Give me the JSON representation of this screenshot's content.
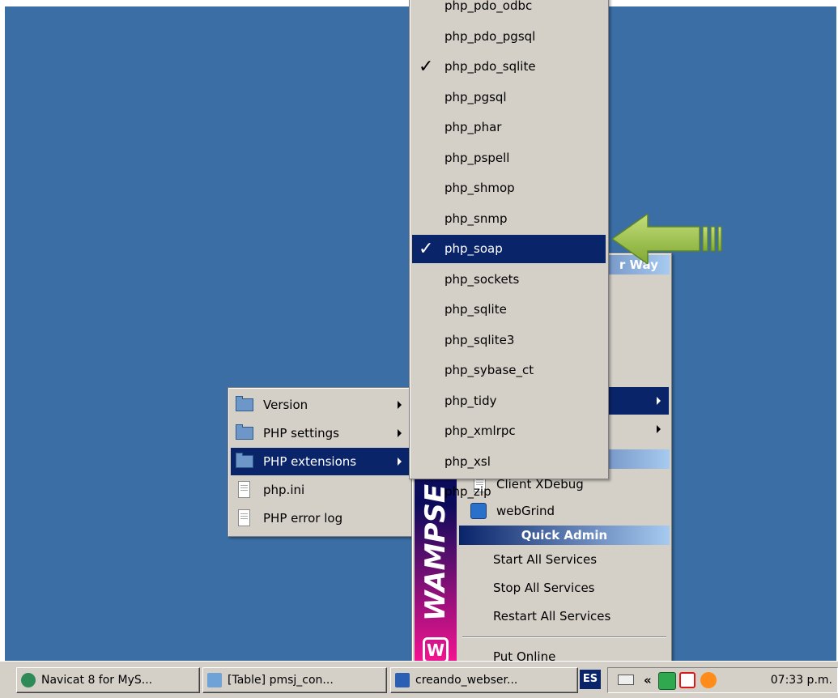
{
  "colors": {
    "desktop": "#3A6EA5",
    "menu": "#D4D0C8",
    "highlight": "#0A246A",
    "arrow": "#8DB43C"
  },
  "ext_menu": {
    "items": [
      {
        "label": "php_pdo_odbc",
        "checked": false
      },
      {
        "label": "php_pdo_pgsql",
        "checked": false
      },
      {
        "label": "php_pdo_sqlite",
        "checked": true
      },
      {
        "label": "php_pgsql",
        "checked": false
      },
      {
        "label": "php_phar",
        "checked": false
      },
      {
        "label": "php_pspell",
        "checked": false
      },
      {
        "label": "php_shmop",
        "checked": false
      },
      {
        "label": "php_snmp",
        "checked": false
      },
      {
        "label": "php_soap",
        "checked": true,
        "selected": true
      },
      {
        "label": "php_sockets",
        "checked": false
      },
      {
        "label": "php_sqlite",
        "checked": false
      },
      {
        "label": "php_sqlite3",
        "checked": false
      },
      {
        "label": "php_sybase_ct",
        "checked": false
      },
      {
        "label": "php_tidy",
        "checked": false
      },
      {
        "label": "php_xmlrpc",
        "checked": false
      },
      {
        "label": "php_xsl",
        "checked": false
      },
      {
        "label": "php_zip",
        "checked": false
      }
    ],
    "check_glyph": "✓"
  },
  "php_menu": {
    "items": [
      {
        "label": "Version",
        "icon": "folder-icon",
        "submenu": true
      },
      {
        "label": "PHP settings",
        "icon": "folder-icon",
        "submenu": true
      },
      {
        "label": "PHP extensions",
        "icon": "folder-icon",
        "submenu": true,
        "selected": true
      },
      {
        "label": "php.ini",
        "icon": "document-icon",
        "submenu": false
      },
      {
        "label": "PHP error log",
        "icon": "document-icon",
        "submenu": false
      }
    ]
  },
  "wamp_menu": {
    "header_partial": "r Way",
    "brand_vertical": "WAMPSE",
    "brand_logo": "W",
    "client_xdebug": "Client XDebug",
    "webgrind": "webGrind",
    "quick_admin": "Quick Admin",
    "start_all": "Start All Services",
    "stop_all": "Stop All Services",
    "restart_all": "Restart All Services",
    "put_online": "Put Online"
  },
  "taskbar": {
    "buttons": [
      {
        "label": "Navicat 8 for MyS...",
        "icon": "navicat-icon"
      },
      {
        "label": "[Table] pmsj_con...",
        "icon": "table-icon"
      },
      {
        "label": "creando_webser...",
        "icon": "word-icon"
      }
    ],
    "lang": "ES",
    "expand": "«",
    "clock": "07:33 p.m."
  }
}
